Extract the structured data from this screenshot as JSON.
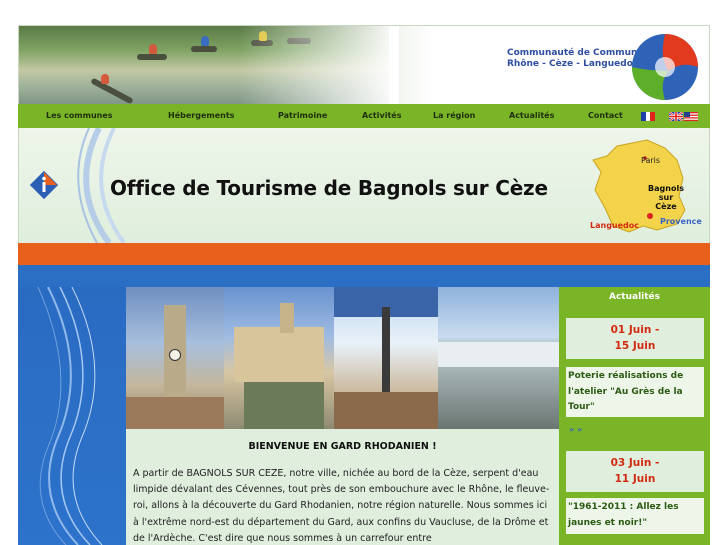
{
  "banner": {
    "community_line1": "Communauté de Communes",
    "community_line2": "Rhône - Cèze - Languedoc"
  },
  "nav": {
    "items": [
      {
        "label": "Les communes"
      },
      {
        "label": "Hébergements"
      },
      {
        "label": "Patrimoine"
      },
      {
        "label": "Activités"
      },
      {
        "label": "La région"
      },
      {
        "label": "Actualités"
      },
      {
        "label": "Contact"
      }
    ]
  },
  "header": {
    "title": "Office de Tourisme de Bagnols sur Cèze",
    "map": {
      "paris": "Paris",
      "bagnols_line1": "Bagnols",
      "bagnols_line2": "sur",
      "bagnols_line3": "Cèze",
      "languedoc": "Languedoc",
      "provence": "Provence"
    }
  },
  "content": {
    "welcome": "BIENVENUE EN GARD RHODANIEN !",
    "intro": "A partir de BAGNOLS SUR CEZE, notre ville, nichée au bord de la Cèze, serpent d'eau limpide dévalant des Cévennes, tout près de son embouchure avec le Rhône, le fleuve-roi, allons à la découverte du Gard Rhodanien, notre région naturelle. Nous sommes ici à l'extrême nord-est du département du Gard, aux confins du Vaucluse, de la Drôme et de l'Ardèche. C'est dire que nous sommes à un carrefour entre"
  },
  "news": {
    "title": "Actualités",
    "items": [
      {
        "date_line1": "01 Juin -",
        "date_line2": "15 Juin",
        "text": "Poterie réalisations de l'atelier \"Au Grès de la Tour\"",
        "more": "» »"
      },
      {
        "date_line1": "03 Juin -",
        "date_line2": "11 Juin",
        "text": "\"1961-2011 : Allez les jaunes et noir!\""
      }
    ]
  },
  "colors": {
    "nav_green": "#7ab427",
    "orange_band": "#e8601c",
    "blue_band": "#2b6fc4",
    "news_date_red": "#d22a10"
  }
}
